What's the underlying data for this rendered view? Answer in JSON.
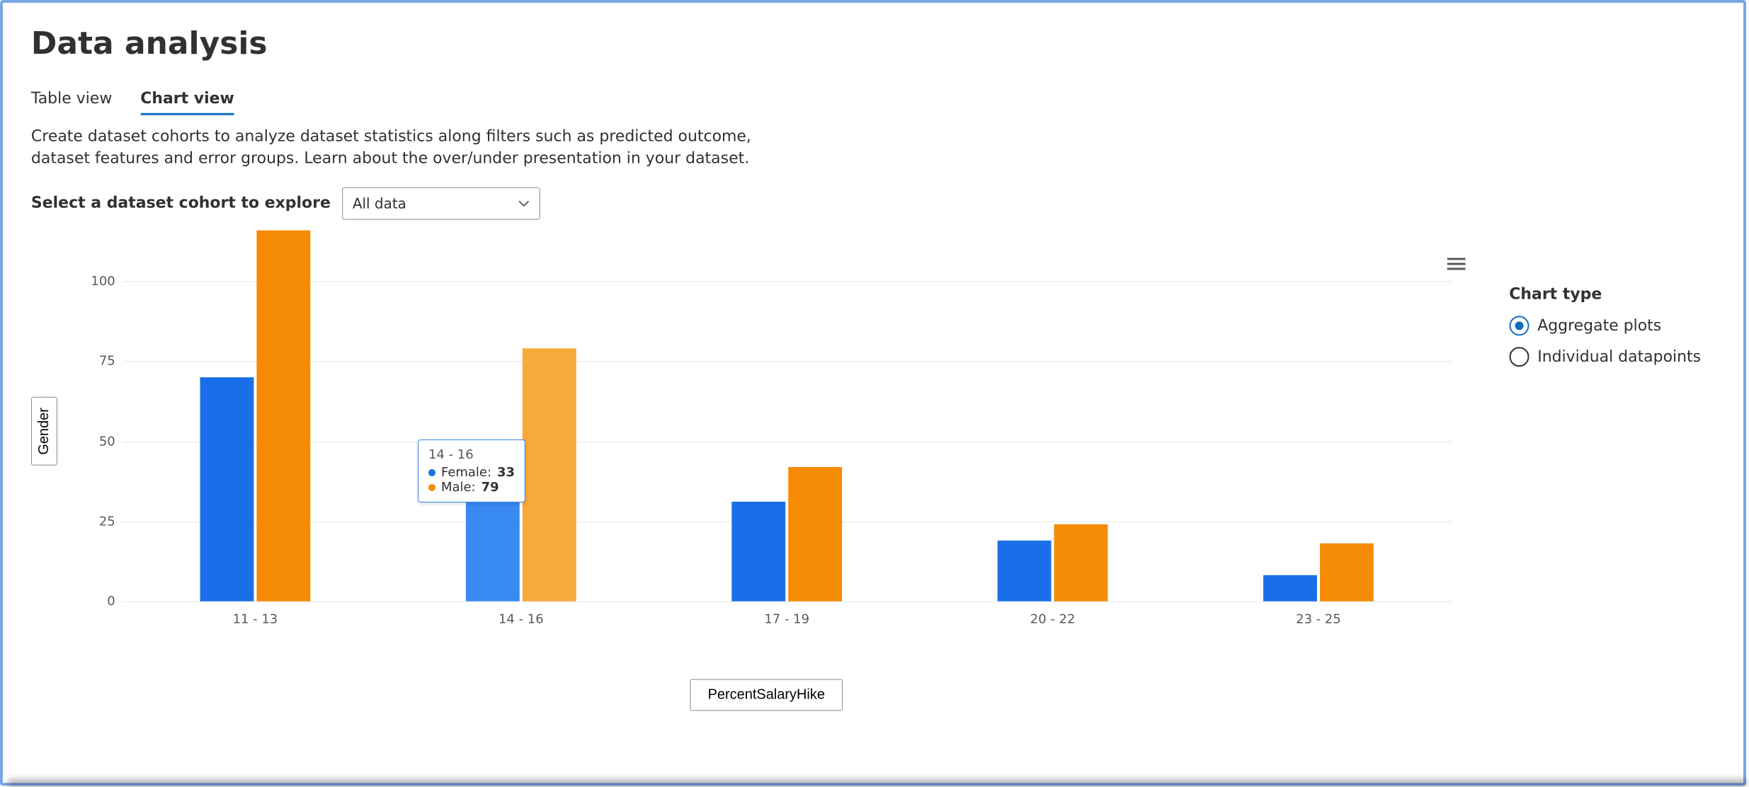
{
  "header": {
    "title": "Data analysis"
  },
  "tabs": [
    {
      "label": "Table view",
      "active": false
    },
    {
      "label": "Chart view",
      "active": true
    }
  ],
  "description": "Create dataset cohorts to analyze dataset statistics along filters such as predicted outcome, dataset features and error groups. Learn about the over/under presentation in your dataset.",
  "cohort": {
    "label": "Select a dataset cohort to explore",
    "selected": "All data"
  },
  "yaxis_button": "Gender",
  "xaxis_button": "PercentSalaryHike",
  "chart_type_panel": {
    "title": "Chart type",
    "options": [
      {
        "label": "Aggregate plots",
        "checked": true
      },
      {
        "label": "Individual datapoints",
        "checked": false
      }
    ]
  },
  "tooltip": {
    "category": "14 - 16",
    "rows": [
      {
        "series": "Female",
        "value": 33
      },
      {
        "series": "Male",
        "value": 79
      }
    ]
  },
  "chart_data": {
    "type": "bar",
    "xlabel": "PercentSalaryHike",
    "ylabel": "Gender",
    "ylim": [
      0,
      115
    ],
    "yticks": [
      0,
      25,
      50,
      75,
      100
    ],
    "categories": [
      "11 - 13",
      "14 - 16",
      "17 - 19",
      "20 - 22",
      "23 - 25"
    ],
    "series": [
      {
        "name": "Female",
        "color": "#1a6fe8",
        "values": [
          70,
          33,
          31,
          19,
          8
        ]
      },
      {
        "name": "Male",
        "color": "#f58b04",
        "values": [
          116,
          79,
          42,
          24,
          18
        ]
      }
    ],
    "hover_index": 1
  }
}
